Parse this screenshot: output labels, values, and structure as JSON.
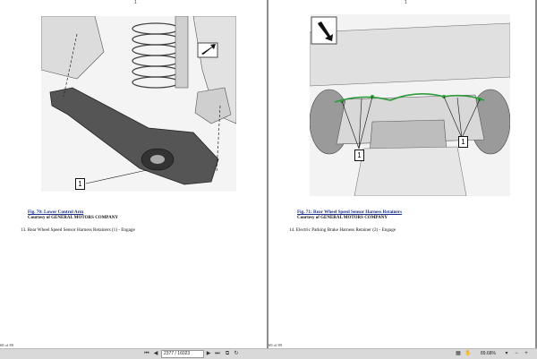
{
  "left_page": {
    "top_marker": "1",
    "callout": "1",
    "caption": "Fig. 70: Lower Control Arm",
    "credit": "Courtesy of GENERAL MOTORS COMPANY",
    "step": "13. Rear Wheel Speed Sensor Harness Retainers (1) - Engage",
    "footer": "68 of 89"
  },
  "right_page": {
    "top_marker": "1",
    "callout": "1",
    "caption": "Fig. 71: Rear Wheel Speed Sensor Harness Retainers",
    "credit": "Courtesy of GENERAL MOTORS COMPANY",
    "step": "14. Electric Parking Brake Harness Retainer (2) - Engage",
    "footer": "69 of 89"
  },
  "toolbar": {
    "page_input": "2377 / 16023",
    "zoom": "89.68%",
    "first_icon": "first-page-icon",
    "prev_icon": "prev-page-icon",
    "next_icon": "next-page-icon",
    "last_icon": "last-page-icon"
  }
}
